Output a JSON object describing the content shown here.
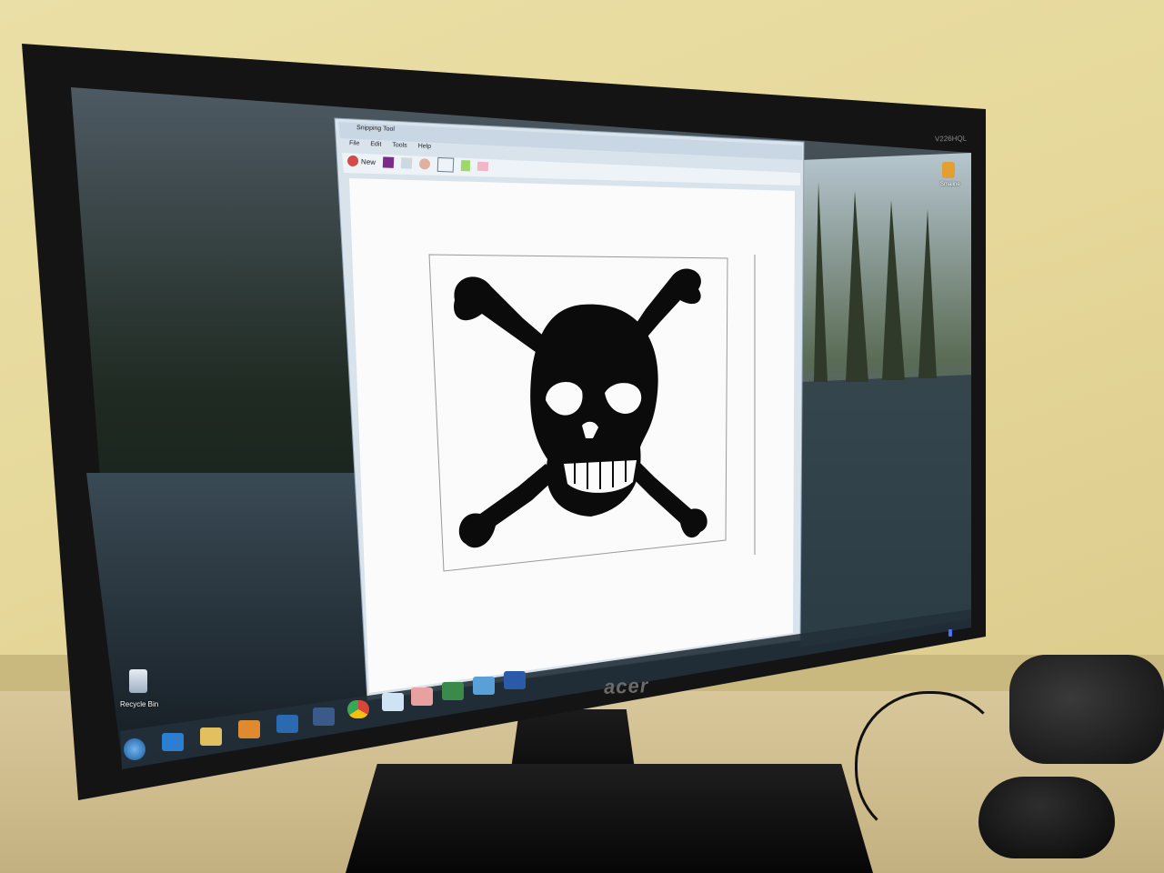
{
  "window": {
    "title": "Snipping Tool",
    "menu": [
      "File",
      "Edit",
      "Tools",
      "Help"
    ],
    "toolbar": {
      "new_label": "New"
    }
  },
  "desktop": {
    "recycle_bin_label": "Recycle Bin",
    "shortcut_label": "Smaline"
  },
  "monitor": {
    "brand": "acer",
    "model": "V226HQL"
  },
  "colors": {
    "wall": "#e6d89a",
    "bezel": "#141414",
    "canvas": "#fbfbfb",
    "skull": "#0b0b0b",
    "power_led": "#4a70ff"
  },
  "taskbar_icons": [
    "start-orb-icon",
    "internet-explorer-icon",
    "file-explorer-icon",
    "media-player-icon",
    "outlook-icon",
    "wifi-icon",
    "chrome-icon",
    "notepad-icon",
    "snipping-tool-icon",
    "project-icon",
    "photo-viewer-icon",
    "word-icon"
  ]
}
